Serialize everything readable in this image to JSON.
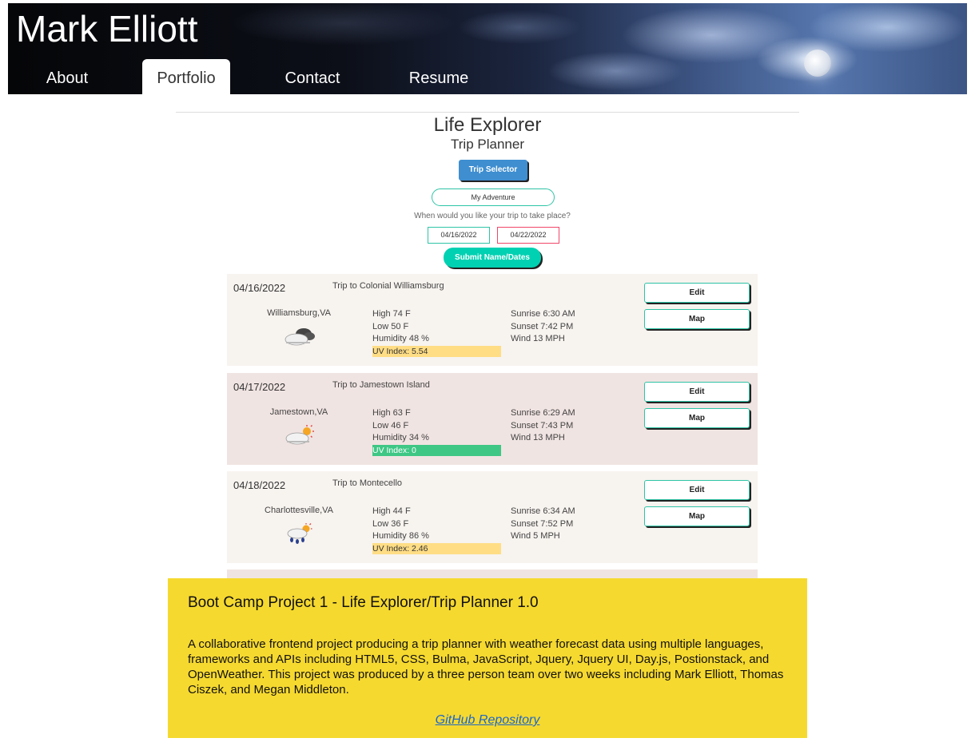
{
  "header": {
    "site_name": "Mark Elliott",
    "nav": [
      {
        "label": "About",
        "active": false
      },
      {
        "label": "Portfolio",
        "active": true
      },
      {
        "label": "Contact",
        "active": false
      },
      {
        "label": "Resume",
        "active": false
      }
    ]
  },
  "project_screenshot": {
    "title": "Life Explorer",
    "subtitle": "Trip Planner",
    "trip_selector_label": "Trip Selector",
    "adventure_value": "My Adventure",
    "when_prompt": "When would you like your trip to take place?",
    "start_date": "04/16/2022",
    "end_date": "04/22/2022",
    "submit_label": "Submit Name/Dates",
    "trips": [
      {
        "date": "04/16/2022",
        "name": "Trip to Colonial Williamsburg",
        "city": "Williamsburg,VA",
        "icon": "cloudy-icon",
        "high": "High 74 F",
        "low": "Low 50 F",
        "humidity": "Humidity 48 %",
        "uv": "UV Index: 5.54",
        "uv_level": "moderate",
        "sunrise": "Sunrise 6:30 AM",
        "sunset": "Sunset 7:42 PM",
        "wind": "Wind 13 MPH",
        "edit_label": "Edit",
        "map_label": "Map"
      },
      {
        "date": "04/17/2022",
        "name": "Trip to Jamestown Island",
        "city": "Jamestown,VA",
        "icon": "partly-sunny-icon",
        "high": "High 63 F",
        "low": "Low 46 F",
        "humidity": "Humidity 34 %",
        "uv": "UV Index: 0",
        "uv_level": "low",
        "sunrise": "Sunrise 6:29 AM",
        "sunset": "Sunset 7:43 PM",
        "wind": "Wind 13 MPH",
        "edit_label": "Edit",
        "map_label": "Map"
      },
      {
        "date": "04/18/2022",
        "name": "Trip to Montecello",
        "city": "Charlottesville,VA",
        "icon": "sun-rain-icon",
        "high": "High 44 F",
        "low": "Low 36 F",
        "humidity": "Humidity 86 %",
        "uv": "UV Index: 2.46",
        "uv_level": "moderate",
        "sunrise": "Sunrise 6:34 AM",
        "sunset": "Sunset 7:52 PM",
        "wind": "Wind 5 MPH",
        "edit_label": "Edit",
        "map_label": "Map"
      }
    ]
  },
  "caption": {
    "title": "Boot Camp Project 1 - Life Explorer/Trip Planner 1.0",
    "description": "A collaborative frontend project producing a trip planner with weather forecast data using multiple languages, frameworks and APIs including HTML5, CSS, Bulma, JavaScript, Jquery, Jquery UI, Day.js, Postionstack, and OpenWeather. This project was produced by a three person team over two weeks including Mark Elliott, Thomas Ciszek, and Megan Middleton.",
    "link_label": "GitHub Repository"
  },
  "colors": {
    "caption_bg": "#f6d92f",
    "link": "#1a66cc",
    "uv_moderate": "#ffdd85",
    "uv_low": "#3ec785",
    "accent_teal": "#00d1b2",
    "accent_blue": "#3e8ed0"
  }
}
